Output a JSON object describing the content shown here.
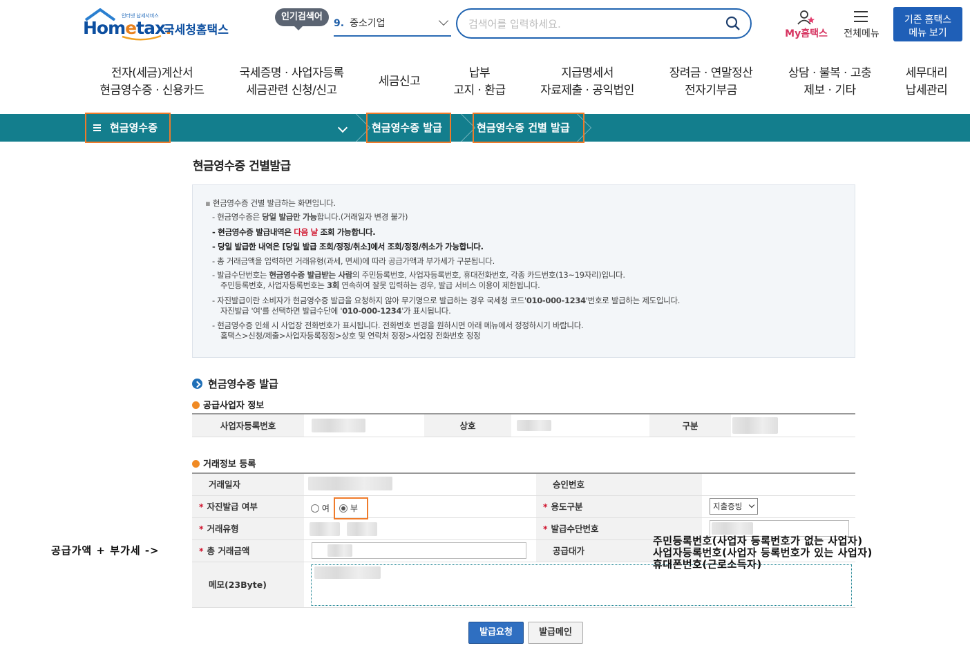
{
  "header": {
    "logo": {
      "home": "Hom",
      "e": "e",
      "tax": "tax",
      "dot": ".",
      "kr": "국세청홈택스",
      "small": "인터넷 납세서비스"
    },
    "hot_badge": "인기검색어",
    "hot_keyword": {
      "num": "9.",
      "text": "중소기업"
    },
    "search": {
      "placeholder": "검색어를 입력하세요."
    },
    "my_hometax": "My홈택스",
    "all_menu": "전체메뉴",
    "old_menu_btn": [
      "기존 홈택스",
      "메뉴 보기"
    ]
  },
  "gnb": [
    [
      "전자(세금)계산서",
      "현금영수증 · 신용카드"
    ],
    [
      "국세증명 · 사업자등록",
      "세금관련 신청/신고"
    ],
    [
      "세금신고"
    ],
    [
      "납부",
      "고지 · 환급"
    ],
    [
      "지급명세서",
      "자료제출 · 공익법인"
    ],
    [
      "장려금 · 연말정산",
      "전자기부금"
    ],
    [
      "상담 · 불복 · 고충",
      "제보 · 기타"
    ],
    [
      "세무대리",
      "납세관리"
    ]
  ],
  "breadcrumb": {
    "l1": "현금영수증",
    "l2": "현금영수증 발급",
    "l3": "현금영수증 건별 발급"
  },
  "page_title": "현금영수증 건별발급",
  "info": {
    "l1": "현금영수증 건별 발급하는 화면입니다.",
    "l2a": "- 현금영수증은 ",
    "l2b": "당일 발급만 가능",
    "l2c": "합니다.(거래일자 변경 불가)",
    "l3a": "- 현금영수증 발급내역은 ",
    "l3b": "다음 날",
    "l3c": " 조회 가능합니다.",
    "l4": "- 당일 발급한 내역은 [당일 발급 조회/정정/취소]에서 조회/정정/취소가 가능합니다.",
    "l5": "- 총 거래금액을 입력하면 거래유형(과세, 면세)에 따라 공급가액과 부가세가 구분됩니다.",
    "l6a": "- 발급수단번호는 ",
    "l6b": "현금영수증 발급받는 사람",
    "l6c": "의   주민등록번호, 사업자등록번호, 휴대전화번호, 각종 카드번호(13~19자리)입니다.",
    "l7a": "주민등록번호, 사업자등록번호는 ",
    "l7b": "3회",
    "l7c": " 연속하여 잘못 입력하는 경우, 발급 서비스 이용이 제한됩니다.",
    "l8a": "- 자진발급이란 소비자가 현금영수증 발급을 요청하지 않아 무기명으로 발급하는 경우 국세청 코드'",
    "l8b": "010-000-1234",
    "l8c": "'번호로 발급하는 제도입니다.",
    "l9a": "자진발급 '여'를 선택하면 발급수단에 '",
    "l9b": "010-000-1234",
    "l9c": "'가 표시됩니다.",
    "l10": "- 현금영수증 인쇄 시 사업장 전화번호가 표시됩니다. 전화번호 변경을 원하시면 아래 메뉴에서 정정하시기 바랍니다.",
    "l11": "홈택스>신청/제출>사업자등록정정>상호 및 연락처 정정>사업장 전화번호 정정"
  },
  "section_title": "현금영수증 발급",
  "supplier": {
    "title": "공급사업자 정보",
    "labels": [
      "사업자등록번호",
      "상호",
      "구분"
    ]
  },
  "trade": {
    "title": "거래정보 등록",
    "date_label": "거래일자",
    "approval_label": "승인번호",
    "self_issue_label": "자진발급 여부",
    "self_issue_yes": "여",
    "self_issue_no": "부",
    "purpose_label": "용도구분",
    "purpose_value": "지출증빙",
    "type_label": "거래유형",
    "means_label": "발급수단번호",
    "total_label": "총 거래금액",
    "supply_label": "공급대가",
    "memo_label": "메모(23Byte)",
    "required_mark": "*"
  },
  "buttons": {
    "request": "발급요청",
    "main": "발급메인"
  },
  "annotations": {
    "left": "공급가액 + 부가세 ->",
    "right": [
      "주민등록번호(사업자 등록번호가 없는 사업자)",
      "사업자등록번호(사업자 등록번호가 있는 사업자)",
      "휴대폰번호(근로소득자)"
    ]
  },
  "colors": {
    "teal": "#137e8d",
    "highlight": "#f07b2a",
    "brand": "#0d4fa0",
    "button": "#1f5fb7"
  }
}
